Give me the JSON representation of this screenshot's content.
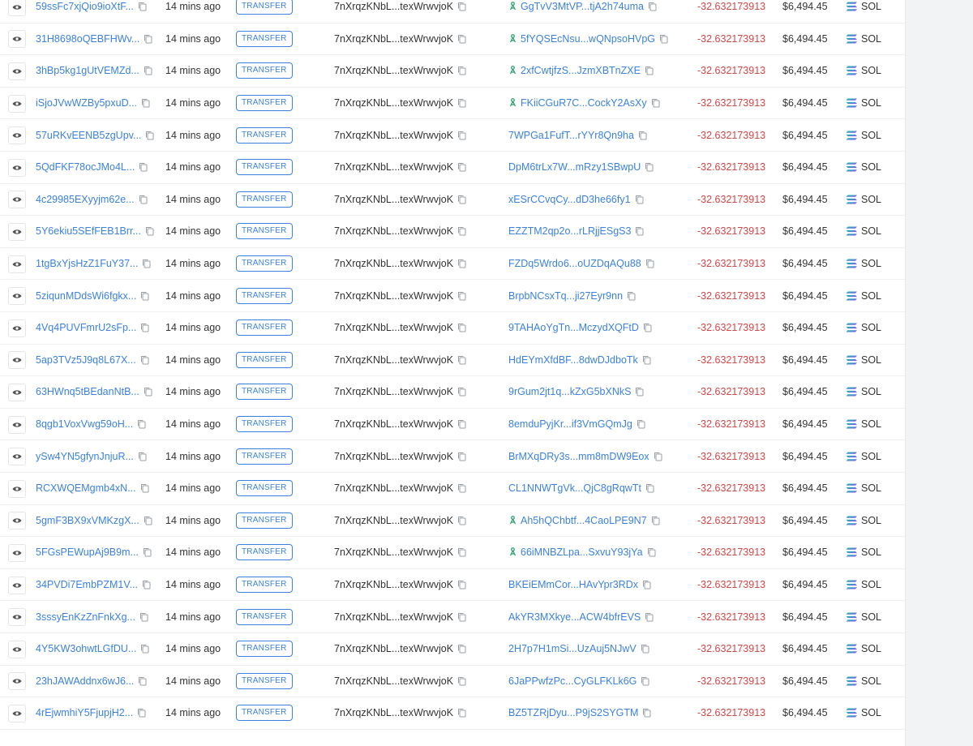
{
  "colors": {
    "link": "#3b82e0",
    "negative": "#d64545",
    "badge_border": "#3b82e0"
  },
  "rows": [
    {
      "signature": "59ssFc7xjQio9ioXtF...",
      "time": "14 mins ago",
      "type": "TRANSFER",
      "from": "7nXrqzKNbL...texWrwvjoK",
      "to": "GgTvV3MtVP...tjA2h74uma",
      "to_program": true,
      "amount": "-32.632173913",
      "value": "$6,494.45",
      "token": "SOL"
    },
    {
      "signature": "31H8698oQEBFHWv...",
      "time": "14 mins ago",
      "type": "TRANSFER",
      "from": "7nXrqzKNbL...texWrwvjoK",
      "to": "5fYQSEcNsu...wQNpsoHVpG",
      "to_program": true,
      "amount": "-32.632173913",
      "value": "$6,494.45",
      "token": "SOL"
    },
    {
      "signature": "3hBp5kg1gUtVEMZd...",
      "time": "14 mins ago",
      "type": "TRANSFER",
      "from": "7nXrqzKNbL...texWrwvjoK",
      "to": "2xfCwtjfzS...JzmXBTnZXE",
      "to_program": true,
      "amount": "-32.632173913",
      "value": "$6,494.45",
      "token": "SOL"
    },
    {
      "signature": "iSjoJVwWZBy5pxuD...",
      "time": "14 mins ago",
      "type": "TRANSFER",
      "from": "7nXrqzKNbL...texWrwvjoK",
      "to": "FKiiCGuR7C...CockY2AsXy",
      "to_program": true,
      "amount": "-32.632173913",
      "value": "$6,494.45",
      "token": "SOL"
    },
    {
      "signature": "57uRKvEENB5zgUpv...",
      "time": "14 mins ago",
      "type": "TRANSFER",
      "from": "7nXrqzKNbL...texWrwvjoK",
      "to": "7WPGa1FufT...rYYr8Qn9ha",
      "to_program": false,
      "amount": "-32.632173913",
      "value": "$6,494.45",
      "token": "SOL"
    },
    {
      "signature": "5QdFKF78ocJMo4L...",
      "time": "14 mins ago",
      "type": "TRANSFER",
      "from": "7nXrqzKNbL...texWrwvjoK",
      "to": "DpM6trLx7W...mRzy1SBwpU",
      "to_program": false,
      "amount": "-32.632173913",
      "value": "$6,494.45",
      "token": "SOL"
    },
    {
      "signature": "4c29985EXyyjm62e...",
      "time": "14 mins ago",
      "type": "TRANSFER",
      "from": "7nXrqzKNbL...texWrwvjoK",
      "to": "xESrCCvqCy...dD3he66fy1",
      "to_program": false,
      "amount": "-32.632173913",
      "value": "$6,494.45",
      "token": "SOL"
    },
    {
      "signature": "5Y6ekiu5SEfFEB1Brr...",
      "time": "14 mins ago",
      "type": "TRANSFER",
      "from": "7nXrqzKNbL...texWrwvjoK",
      "to": "EZZTM2qp2o...rLRjjESgS3",
      "to_program": false,
      "amount": "-32.632173913",
      "value": "$6,494.45",
      "token": "SOL"
    },
    {
      "signature": "1tgBxYjsHzZ1FuY37...",
      "time": "14 mins ago",
      "type": "TRANSFER",
      "from": "7nXrqzKNbL...texWrwvjoK",
      "to": "FZDq5Wrdo6...oUZDqAQu88",
      "to_program": false,
      "amount": "-32.632173913",
      "value": "$6,494.45",
      "token": "SOL"
    },
    {
      "signature": "5ziqunMDdsWi6fgkx...",
      "time": "14 mins ago",
      "type": "TRANSFER",
      "from": "7nXrqzKNbL...texWrwvjoK",
      "to": "BrpbNCsxTq...ji27Eyr9nn",
      "to_program": false,
      "amount": "-32.632173913",
      "value": "$6,494.45",
      "token": "SOL"
    },
    {
      "signature": "4Vq4PUVFmrU2sFp...",
      "time": "14 mins ago",
      "type": "TRANSFER",
      "from": "7nXrqzKNbL...texWrwvjoK",
      "to": "9TAHAoYgTn...MczydXQFtD",
      "to_program": false,
      "amount": "-32.632173913",
      "value": "$6,494.45",
      "token": "SOL"
    },
    {
      "signature": "5ap3TVz5J9q8L67X...",
      "time": "14 mins ago",
      "type": "TRANSFER",
      "from": "7nXrqzKNbL...texWrwvjoK",
      "to": "HdEYmXfdBF...8dwDJdboTk",
      "to_program": false,
      "amount": "-32.632173913",
      "value": "$6,494.45",
      "token": "SOL"
    },
    {
      "signature": "63HWnq5tBEdanNtB...",
      "time": "14 mins ago",
      "type": "TRANSFER",
      "from": "7nXrqzKNbL...texWrwvjoK",
      "to": "9rGum2jt1q...kZxG5bXNkS",
      "to_program": false,
      "amount": "-32.632173913",
      "value": "$6,494.45",
      "token": "SOL"
    },
    {
      "signature": "8qgb1VoxVwg59oH...",
      "time": "14 mins ago",
      "type": "TRANSFER",
      "from": "7nXrqzKNbL...texWrwvjoK",
      "to": "8emduPyjKr...if3VmGQmJg",
      "to_program": false,
      "amount": "-32.632173913",
      "value": "$6,494.45",
      "token": "SOL"
    },
    {
      "signature": "ySw4YN5gfynJnjuR...",
      "time": "14 mins ago",
      "type": "TRANSFER",
      "from": "7nXrqzKNbL...texWrwvjoK",
      "to": "BrMXqDRy3s...mm8mDW9Eox",
      "to_program": false,
      "amount": "-32.632173913",
      "value": "$6,494.45",
      "token": "SOL"
    },
    {
      "signature": "RCXWQEMgmb4xN...",
      "time": "14 mins ago",
      "type": "TRANSFER",
      "from": "7nXrqzKNbL...texWrwvjoK",
      "to": "CL1NNWTgVk...QjC8gRqwTt",
      "to_program": false,
      "amount": "-32.632173913",
      "value": "$6,494.45",
      "token": "SOL"
    },
    {
      "signature": "5gmF3BX9xVMKzgX...",
      "time": "14 mins ago",
      "type": "TRANSFER",
      "from": "7nXrqzKNbL...texWrwvjoK",
      "to": "Ah5hQChbtf...4CaoLPE9N7",
      "to_program": true,
      "amount": "-32.632173913",
      "value": "$6,494.45",
      "token": "SOL"
    },
    {
      "signature": "5FGsPEWupAj9B9m...",
      "time": "14 mins ago",
      "type": "TRANSFER",
      "from": "7nXrqzKNbL...texWrwvjoK",
      "to": "66iMNBZLpa...SxvuY93jYa",
      "to_program": true,
      "amount": "-32.632173913",
      "value": "$6,494.45",
      "token": "SOL"
    },
    {
      "signature": "34PVDi7EmbPZM1V...",
      "time": "14 mins ago",
      "type": "TRANSFER",
      "from": "7nXrqzKNbL...texWrwvjoK",
      "to": "BKEiEMmCor...HAvYpr3RDx",
      "to_program": false,
      "amount": "-32.632173913",
      "value": "$6,494.45",
      "token": "SOL"
    },
    {
      "signature": "3sssyEnKzZnFnkXg...",
      "time": "14 mins ago",
      "type": "TRANSFER",
      "from": "7nXrqzKNbL...texWrwvjoK",
      "to": "AkYR3MXkye...ACW4bfrEVS",
      "to_program": false,
      "amount": "-32.632173913",
      "value": "$6,494.45",
      "token": "SOL"
    },
    {
      "signature": "4Y5KW3ohwtLGfDU...",
      "time": "14 mins ago",
      "type": "TRANSFER",
      "from": "7nXrqzKNbL...texWrwvjoK",
      "to": "2H7p7H1mSi...UzAuj5NJwV",
      "to_program": false,
      "amount": "-32.632173913",
      "value": "$6,494.45",
      "token": "SOL"
    },
    {
      "signature": "23hJAWAddnx6wJ6...",
      "time": "14 mins ago",
      "type": "TRANSFER",
      "from": "7nXrqzKNbL...texWrwvjoK",
      "to": "6JaPPwfzPc...CyGLFKLk6G",
      "to_program": false,
      "amount": "-32.632173913",
      "value": "$6,494.45",
      "token": "SOL"
    },
    {
      "signature": "4rEjwmhiY5FjupjH2...",
      "time": "14 mins ago",
      "type": "TRANSFER",
      "from": "7nXrqzKNbL...texWrwvjoK",
      "to": "BZ5TZRjDyu...P9jS2SYGTM",
      "to_program": false,
      "amount": "-32.632173913",
      "value": "$6,494.45",
      "token": "SOL"
    }
  ]
}
